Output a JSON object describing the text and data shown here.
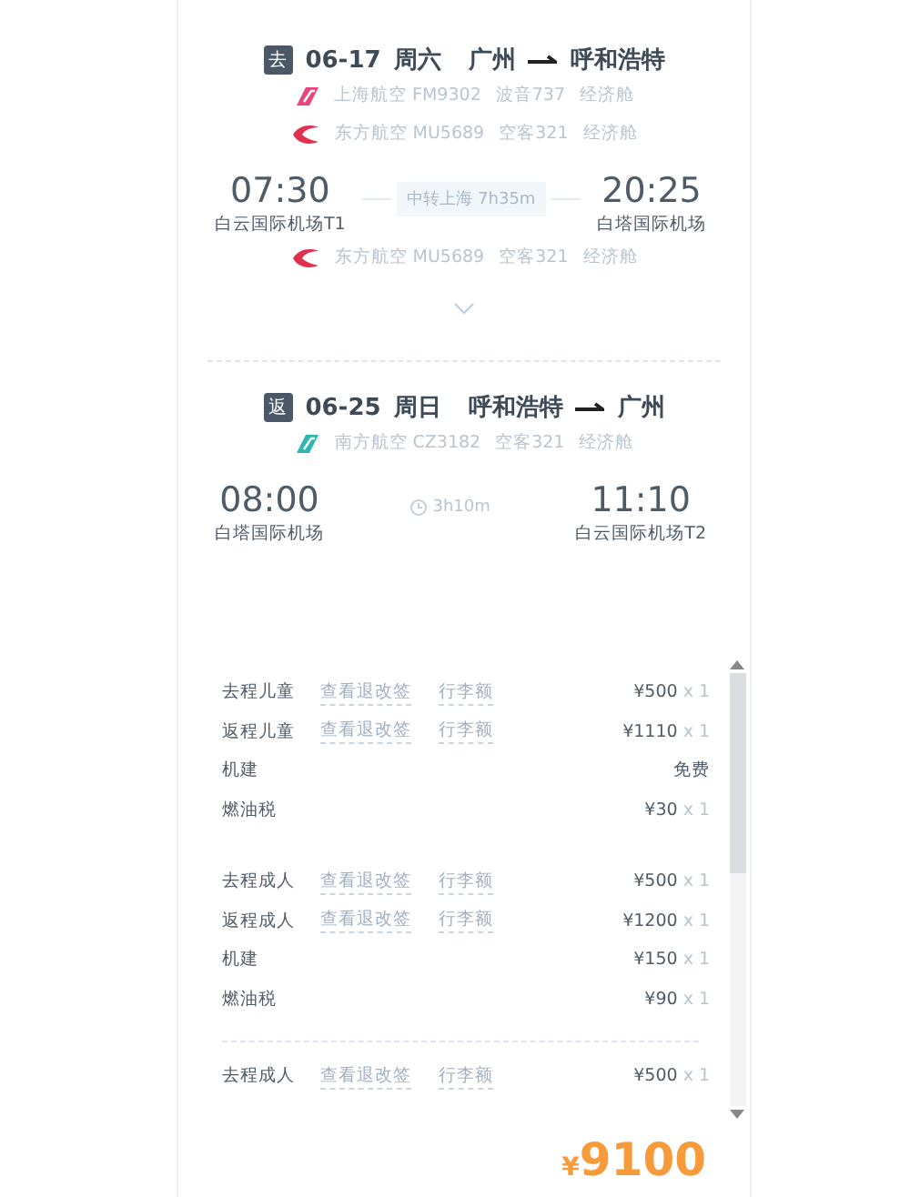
{
  "trips": [
    {
      "badge": "去",
      "date": "06-17",
      "weekday": "周六",
      "from": "广州",
      "to": "呼和浩特",
      "flights_before": [
        {
          "kind": "tail",
          "color": "#e8457a",
          "airline": "上海航空 FM9302",
          "aircraft": "波音737",
          "cabin": "经济舱"
        },
        {
          "kind": "bird",
          "color": "#e0304e",
          "airline": "东方航空 MU5689",
          "aircraft": "空客321",
          "cabin": "经济舱"
        }
      ],
      "departure_time": "07:30",
      "departure_airport": "白云国际机场T1",
      "middle": {
        "kind": "transfer",
        "text": "中转上海 7h35m"
      },
      "arrival_time": "20:25",
      "arrival_airport": "白塔国际机场",
      "flights_after": [
        {
          "kind": "bird",
          "color": "#e0304e",
          "airline": "东方航空 MU5689",
          "aircraft": "空客321",
          "cabin": "经济舱"
        }
      ],
      "expandable": true
    },
    {
      "badge": "返",
      "date": "06-25",
      "weekday": "周日",
      "from": "呼和浩特",
      "to": "广州",
      "flights_before": [
        {
          "kind": "tail",
          "color": "#2cb7b0",
          "airline": "南方航空 CZ3182",
          "aircraft": "空客321",
          "cabin": "经济舱"
        }
      ],
      "departure_time": "08:00",
      "departure_airport": "白塔国际机场",
      "middle": {
        "kind": "duration",
        "text": "3h10m"
      },
      "arrival_time": "11:10",
      "arrival_airport": "白云国际机场T2"
    }
  ],
  "price_groups": [
    {
      "rows": [
        {
          "label": "去程儿童",
          "links": [
            "查看退改签",
            "行李额"
          ],
          "price": "¥500",
          "qty": "x 1"
        },
        {
          "label": "返程儿童",
          "links": [
            "查看退改签",
            "行李额"
          ],
          "price": "¥1110",
          "qty": "x 1"
        },
        {
          "label": "机建",
          "links": [],
          "price": "免费"
        },
        {
          "label": "燃油税",
          "links": [],
          "price": "¥30",
          "qty": "x 1"
        }
      ]
    },
    {
      "rows": [
        {
          "label": "去程成人",
          "links": [
            "查看退改签",
            "行李额"
          ],
          "price": "¥500",
          "qty": "x 1"
        },
        {
          "label": "返程成人",
          "links": [
            "查看退改签",
            "行李额"
          ],
          "price": "¥1200",
          "qty": "x 1"
        },
        {
          "label": "机建",
          "links": [],
          "price": "¥150",
          "qty": "x 1"
        },
        {
          "label": "燃油税",
          "links": [],
          "price": "¥90",
          "qty": "x 1"
        }
      ]
    },
    {
      "divider_before": true,
      "rows": [
        {
          "label": "去程成人",
          "links": [
            "查看退改签",
            "行李额"
          ],
          "price": "¥500",
          "qty": "x 1"
        }
      ]
    }
  ],
  "total": {
    "currency": "¥",
    "amount": "9100"
  }
}
